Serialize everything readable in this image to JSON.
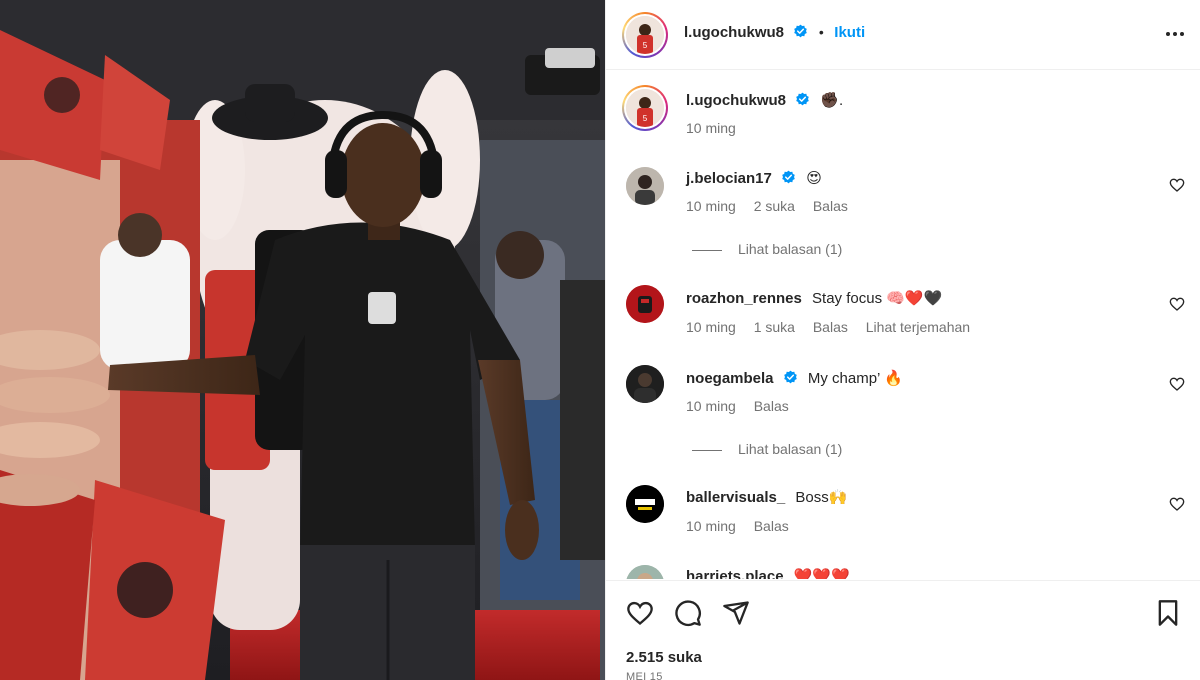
{
  "post": {
    "author": "l.ugochukwu8",
    "follow_label": "Ikuti",
    "separator": "•",
    "caption_username": "l.ugochukwu8",
    "caption_text": "✊🏿.",
    "caption_time": "10 ming"
  },
  "comments": [
    {
      "username": "j.belocian17",
      "verified": true,
      "text": "😍",
      "time": "10 ming",
      "likes": "2 suka",
      "reply": "Balas",
      "translate": "",
      "view_replies": "Lihat balasan (1)"
    },
    {
      "username": "roazhon_rennes",
      "verified": false,
      "text": "Stay focus 🧠❤️🖤",
      "time": "10 ming",
      "likes": "1 suka",
      "reply": "Balas",
      "translate": "Lihat terjemahan",
      "view_replies": ""
    },
    {
      "username": "noegambela",
      "verified": true,
      "text": "My champ’ 🔥",
      "time": "10 ming",
      "likes": "",
      "reply": "Balas",
      "translate": "",
      "view_replies": "Lihat balasan (1)"
    },
    {
      "username": "ballervisuals_",
      "verified": false,
      "text": "Boss🙌",
      "time": "10 ming",
      "likes": "",
      "reply": "Balas",
      "translate": "",
      "view_replies": ""
    },
    {
      "username": "harriets.place",
      "verified": false,
      "text": "❤️❤️❤️",
      "time": "",
      "likes": "",
      "reply": "",
      "translate": "",
      "view_replies": ""
    }
  ],
  "footer": {
    "likes": "2.515 suka",
    "date": "MEI 15"
  },
  "icons": {
    "more": "more-icon",
    "heart": "heart-icon",
    "comment": "comment-icon",
    "share": "share-icon",
    "bookmark": "bookmark-icon",
    "verified": "verified-badge-icon"
  },
  "colors": {
    "follow_blue": "#0095f6",
    "verified_blue": "#0095f6",
    "text_primary": "#262626",
    "text_secondary": "#737373",
    "divider": "#efefef"
  }
}
